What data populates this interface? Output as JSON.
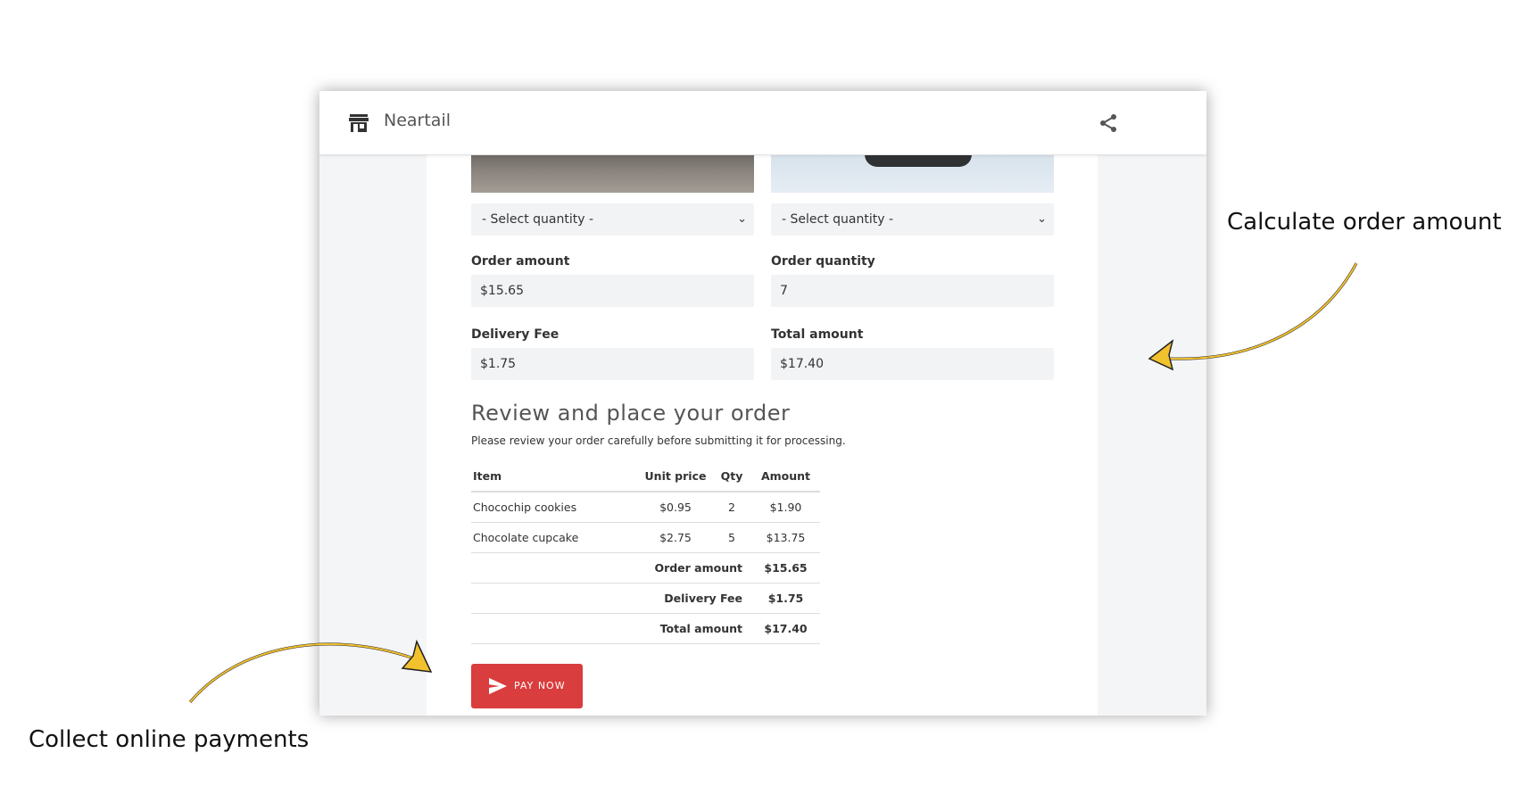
{
  "app": {
    "brand": "Neartail"
  },
  "icons": {
    "store": "store-icon",
    "share": "share-icon",
    "send": "send-icon"
  },
  "product_select": {
    "left": {
      "placeholder": "- Select quantity -"
    },
    "right": {
      "placeholder": "- Select quantity -"
    }
  },
  "fields": {
    "order_amount": {
      "label": "Order amount",
      "value": "$15.65"
    },
    "order_quantity": {
      "label": "Order quantity",
      "value": "7"
    },
    "delivery_fee": {
      "label": "Delivery Fee",
      "value": "$1.75"
    },
    "total_amount": {
      "label": "Total amount",
      "value": "$17.40"
    }
  },
  "review": {
    "title": "Review and place your order",
    "subtitle": "Please review your order carefully before submitting it for processing.",
    "headers": {
      "item": "Item",
      "unit_price": "Unit price",
      "qty": "Qty",
      "amount": "Amount"
    },
    "items": [
      {
        "item": "Chocochip cookies",
        "unit_price": "$0.95",
        "qty": "2",
        "amount": "$1.90"
      },
      {
        "item": "Chocolate cupcake",
        "unit_price": "$2.75",
        "qty": "5",
        "amount": "$13.75"
      }
    ],
    "summary": [
      {
        "label": "Order amount",
        "value": "$15.65"
      },
      {
        "label": "Delivery Fee",
        "value": "$1.75"
      },
      {
        "label": "Total amount",
        "value": "$17.40"
      }
    ]
  },
  "pay_button": {
    "label": "PAY NOW"
  },
  "annotations": {
    "right": "Calculate order amount",
    "left": "Collect online payments"
  },
  "colors": {
    "pay_button": "#d93d3d",
    "arrow": "#f2c12e",
    "panel_bg": "#f4f5f7"
  }
}
